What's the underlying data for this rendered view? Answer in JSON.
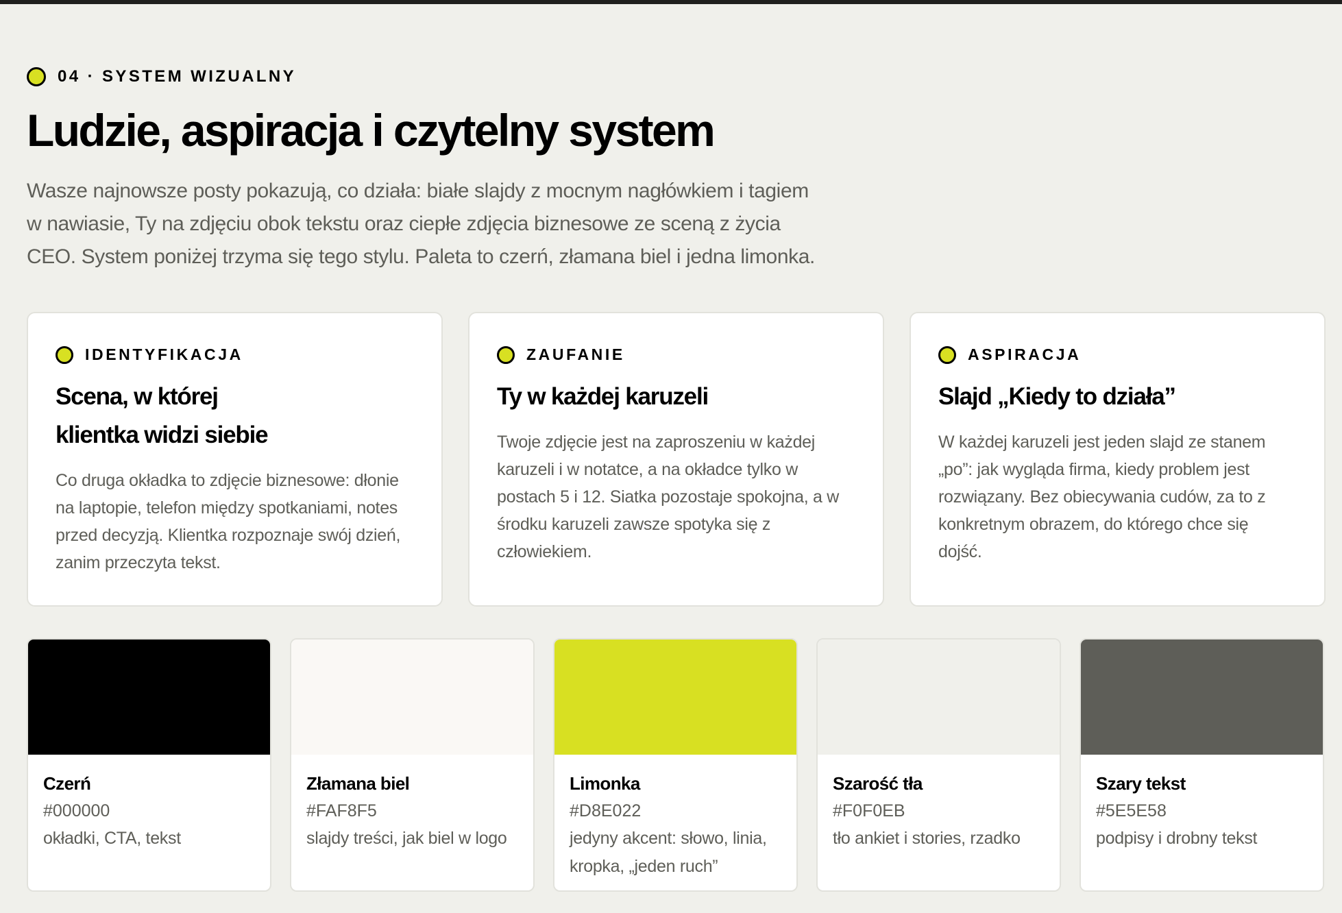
{
  "section": {
    "eyebrow": "04 · SYSTEM WIZUALNY",
    "title": "Ludzie, aspiracja i czytelny system",
    "intro_lines": [
      "Wasze najnowsze posty pokazują, co działa: białe slajdy z mocnym nagłówkiem i tagiem",
      "w nawiasie, Ty na zdjęciu obok tekstu oraz ciepłe zdjęcia biznesowe ze sceną z życia",
      "CEO. System poniżej trzyma się tego stylu. Paleta to czerń, złamana biel i jedna limonka."
    ]
  },
  "cards": [
    {
      "tag": "IDENTYFIKACJA",
      "title_lines": [
        "Scena, w której",
        "klientka widzi siebie"
      ],
      "body_lines": [
        "Co druga okładka to zdjęcie biznesowe: dłonie",
        "na laptopie, telefon między spotkaniami, notes",
        "przed decyzją. Klientka rozpoznaje swój dzień,",
        "zanim przeczyta tekst."
      ]
    },
    {
      "tag": "ZAUFANIE",
      "title_lines": [
        "Ty w każdej karuzeli"
      ],
      "body_lines": [
        "Twoje zdjęcie jest na zaproszeniu w każdej",
        "karuzeli i w notatce, a na okładce tylko w",
        "postach 5 i 12. Siatka pozostaje spokojna, a w",
        "środku karuzeli zawsze spotyka się z",
        "człowiekiem."
      ]
    },
    {
      "tag": "ASPIRACJA",
      "title_lines": [
        "Slajd „Kiedy to działa”"
      ],
      "body_lines": [
        "W każdej karuzeli jest jeden slajd ze stanem",
        "„po”: jak wygląda firma, kiedy problem jest",
        "rozwiązany. Bez obiecywania cudów, za to z",
        "konkretnym obrazem, do którego chce się",
        "dojść."
      ]
    }
  ],
  "palette": [
    {
      "name": "Czerń",
      "hex": "#000000",
      "color": "#000000",
      "use_lines": [
        "okładki, CTA, tekst"
      ]
    },
    {
      "name": "Złamana biel",
      "hex": "#FAF8F5",
      "color": "#FAF8F5",
      "use_lines": [
        "slajdy treści, jak biel w logo"
      ]
    },
    {
      "name": "Limonka",
      "hex": "#D8E022",
      "color": "#D8E022",
      "use_lines": [
        "jedyny akcent: słowo, linia,",
        "kropka, „jeden ruch”"
      ]
    },
    {
      "name": "Szarość tła",
      "hex": "#F0F0EB",
      "color": "#F0F0EB",
      "use_lines": [
        "tło ankiet i stories, rzadko"
      ]
    },
    {
      "name": "Szary tekst",
      "hex": "#5E5E58",
      "color": "#5E5E58",
      "use_lines": [
        "podpisy i drobny tekst"
      ]
    }
  ],
  "colors": {
    "accent": "#D8E022",
    "background": "#F0F0EB",
    "muted_text": "#5E5E58"
  }
}
